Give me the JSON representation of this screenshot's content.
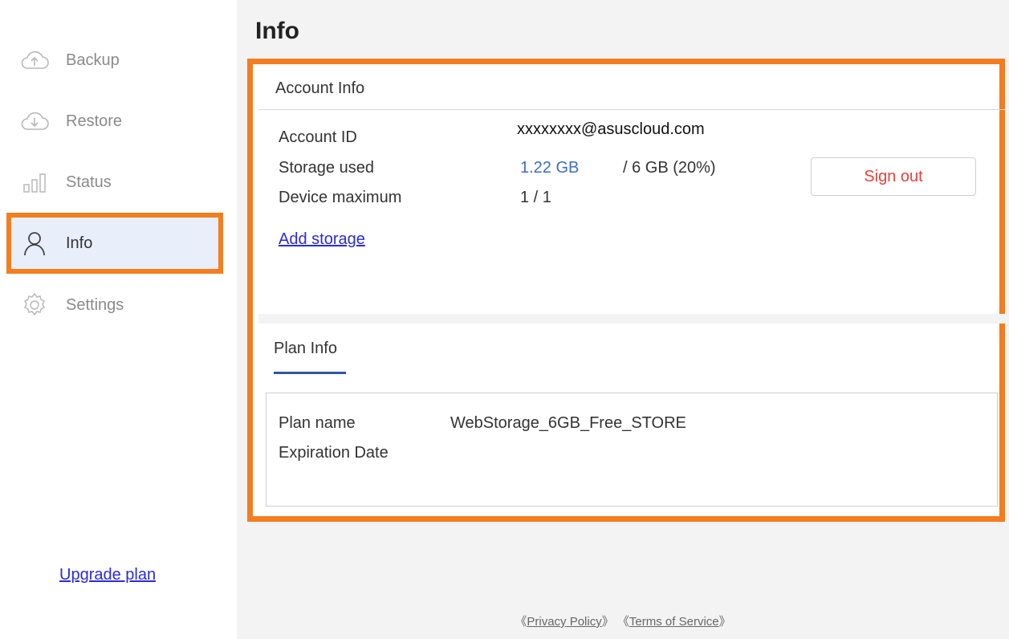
{
  "sidebar": {
    "items": [
      {
        "label": "Backup",
        "icon": "cloud-upload-icon"
      },
      {
        "label": "Restore",
        "icon": "cloud-download-icon"
      },
      {
        "label": "Status",
        "icon": "bar-chart-icon"
      },
      {
        "label": "Info",
        "icon": "user-icon",
        "active": true
      },
      {
        "label": "Settings",
        "icon": "gear-icon"
      }
    ],
    "upgrade_label": "Upgrade plan"
  },
  "main": {
    "title": "Info",
    "account": {
      "header": "Account Info",
      "account_id_label": "Account ID",
      "account_id_value": "xxxxxxxx@asuscloud.com",
      "storage_label": "Storage used",
      "storage_used": "1.22 GB",
      "storage_total": "/ 6 GB (20%)",
      "device_label": "Device maximum",
      "device_value": "1 / 1",
      "add_storage": "Add storage",
      "sign_out": "Sign out"
    },
    "plan": {
      "tab": "Plan Info",
      "plan_name_label": "Plan name",
      "plan_name_value": "WebStorage_6GB_Free_STORE",
      "expiration_label": "Expiration Date"
    },
    "footer": {
      "privacy": "Privacy Policy",
      "terms": "Terms of Service"
    }
  },
  "colors": {
    "accent": "#f47d20",
    "link": "#2b2bd8",
    "signout": "#e8413b",
    "storage_blue": "#3d6fbf"
  }
}
